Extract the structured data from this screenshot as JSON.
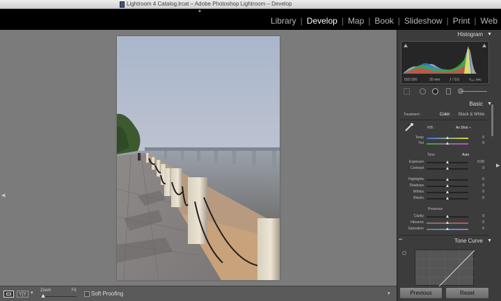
{
  "window": {
    "title": "Lightroom 4 Catalog.lrcat – Adobe Photoshop Lightroom – Develop"
  },
  "modules": [
    "Library",
    "Develop",
    "Map",
    "Book",
    "Slideshow",
    "Print",
    "Web"
  ],
  "active_module": "Develop",
  "toolbar": {
    "zoom_label": "Zoom",
    "fit_label": "Fit",
    "soft_proofing": "Soft Proofing",
    "survey_glyph": "Y|Y"
  },
  "histogram": {
    "title": "Histogram",
    "iso": "ISO 200",
    "focal": "20 mm",
    "aperture": "ƒ / 9.0",
    "shutter": "¹⁄₆₄₀ sec"
  },
  "basic": {
    "title": "Basic",
    "treatment_label": "Treatment :",
    "treatment_color": "Color",
    "treatment_bw": "Black & White",
    "wb_label": "WB :",
    "wb_value": "As Shot ÷",
    "temp": {
      "label": "Temp",
      "value": "0"
    },
    "tint": {
      "label": "Tint",
      "value": "0"
    },
    "tone_label": "Tone",
    "auto_label": "Auto",
    "exposure": {
      "label": "Exposure",
      "value": "0.00"
    },
    "contrast": {
      "label": "Contrast",
      "value": "0"
    },
    "highlights": {
      "label": "Highlights",
      "value": "0"
    },
    "shadows": {
      "label": "Shadows",
      "value": "0"
    },
    "whites": {
      "label": "Whites",
      "value": "0"
    },
    "blacks": {
      "label": "Blacks",
      "value": "0"
    },
    "presence_label": "Presence",
    "clarity": {
      "label": "Clarity",
      "value": "0"
    },
    "vibrance": {
      "label": "Vibrance",
      "value": "0"
    },
    "saturation": {
      "label": "Saturation",
      "value": "0"
    }
  },
  "tone_curve": {
    "title": "Tone Curve"
  },
  "buttons": {
    "previous": "Previous",
    "reset": "Reset"
  }
}
